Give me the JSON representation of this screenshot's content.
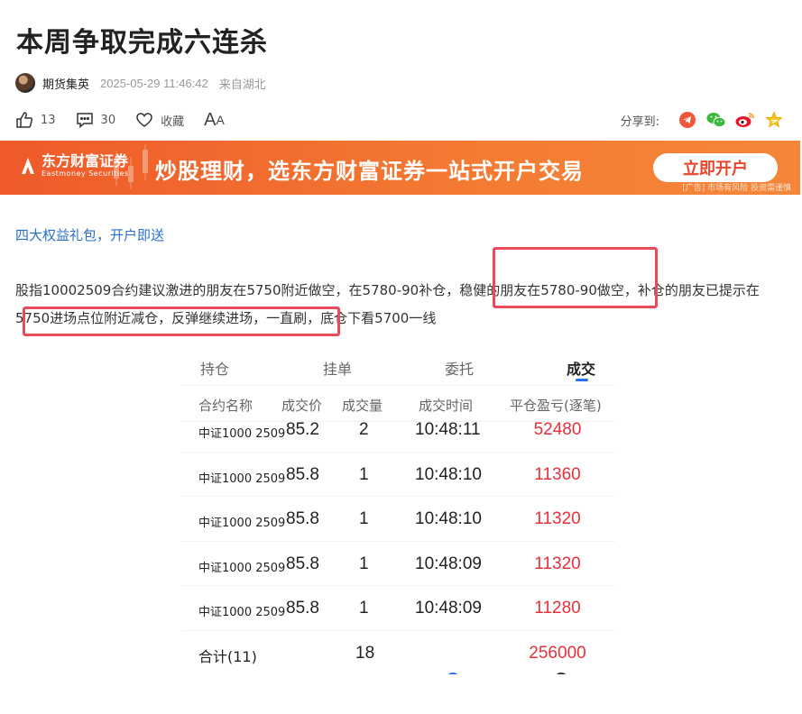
{
  "article": {
    "title": "本周争取完成六连杀",
    "author": "期货集英",
    "datetime": "2025-05-29 11:46:42",
    "location": "来自湖北",
    "likes": "13",
    "comments": "30",
    "favorite_label": "收藏",
    "font_big": "A",
    "font_small": "A",
    "share_label": "分享到:"
  },
  "banner": {
    "brand_cn": "东方财富证券",
    "brand_en": "Eastmoney Securities",
    "slogan": "炒股理财，选东方财富证券一站式开户交易",
    "cta": "立即开户",
    "note": "[广告] 市场有风险 投资需谨慎",
    "colors": {
      "start": "#ee5a2a",
      "end": "#f4873a",
      "cta_text": "#e8452b"
    }
  },
  "promo_link": "四大权益礼包，开户即送",
  "paragraph": {
    "line1": "股指10002509合约建议激进的朋友在5750附近做空，在5780-90补仓，稳健的朋友在5780-90做空，补仓的朋友已提示在",
    "line2": "5750进场点位附近减仓，反弹继续进场，一直刷，底仓下看5700一线"
  },
  "highlight_color": "#ea4a5a",
  "trade_screenshot": {
    "tabs": [
      {
        "label": "持仓",
        "active": false
      },
      {
        "label": "挂单",
        "active": false
      },
      {
        "label": "委托",
        "active": false
      },
      {
        "label": "成交",
        "active": true
      }
    ],
    "headers": [
      "合约名称",
      "成交价",
      "成交量",
      "成交时间",
      "平仓盈亏(逐笔)"
    ],
    "rows": [
      {
        "name": "中证1000 2509",
        "price": "85.2",
        "volume": "2",
        "time": "10:48:11",
        "pnl": "52480"
      },
      {
        "name": "中证1000 2509",
        "price": "85.8",
        "volume": "1",
        "time": "10:48:10",
        "pnl": "11360"
      },
      {
        "name": "中证1000 2509",
        "price": "85.8",
        "volume": "1",
        "time": "10:48:10",
        "pnl": "11320"
      },
      {
        "name": "中证1000 2509",
        "price": "85.8",
        "volume": "1",
        "time": "10:48:09",
        "pnl": "11320"
      },
      {
        "name": "中证1000 2509",
        "price": "85.8",
        "volume": "1",
        "time": "10:48:09",
        "pnl": "11280"
      }
    ],
    "total": {
      "label": "合计(11)",
      "volume": "18",
      "pnl": "256000"
    },
    "colors": {
      "profit": "#e8303c",
      "tab_indicator": "#2a6fe8"
    }
  }
}
